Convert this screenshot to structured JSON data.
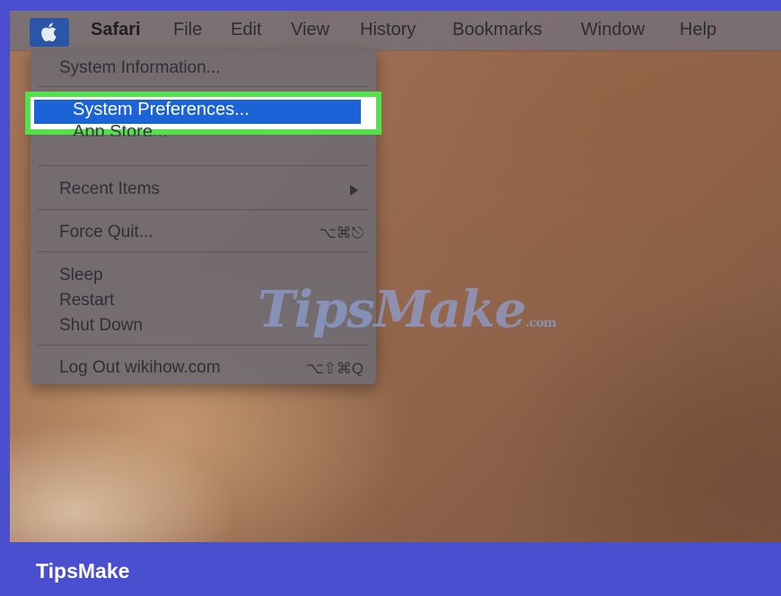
{
  "menubar": {
    "items": [
      "Safari",
      "File",
      "Edit",
      "View",
      "History",
      "Bookmarks",
      "Window",
      "Help"
    ]
  },
  "apple_menu": {
    "system_information": "System Information...",
    "system_preferences": "System Preferences...",
    "app_store": "App Store...",
    "recent_items": "Recent Items",
    "force_quit": "Force Quit...",
    "force_quit_shortcut": "⌥⌘⎋",
    "sleep": "Sleep",
    "restart": "Restart",
    "shut_down": "Shut Down",
    "log_out": "Log Out wikihow.com",
    "log_out_shortcut": "⌥⇧⌘Q"
  },
  "watermark": {
    "main": "TipsMake",
    "suffix": ".com"
  },
  "footer": {
    "brand": "TipsMake"
  },
  "colors": {
    "highlight_border": "#54e24c",
    "selection": "#1d63d8",
    "footer_bg": "#4a4fcf"
  }
}
